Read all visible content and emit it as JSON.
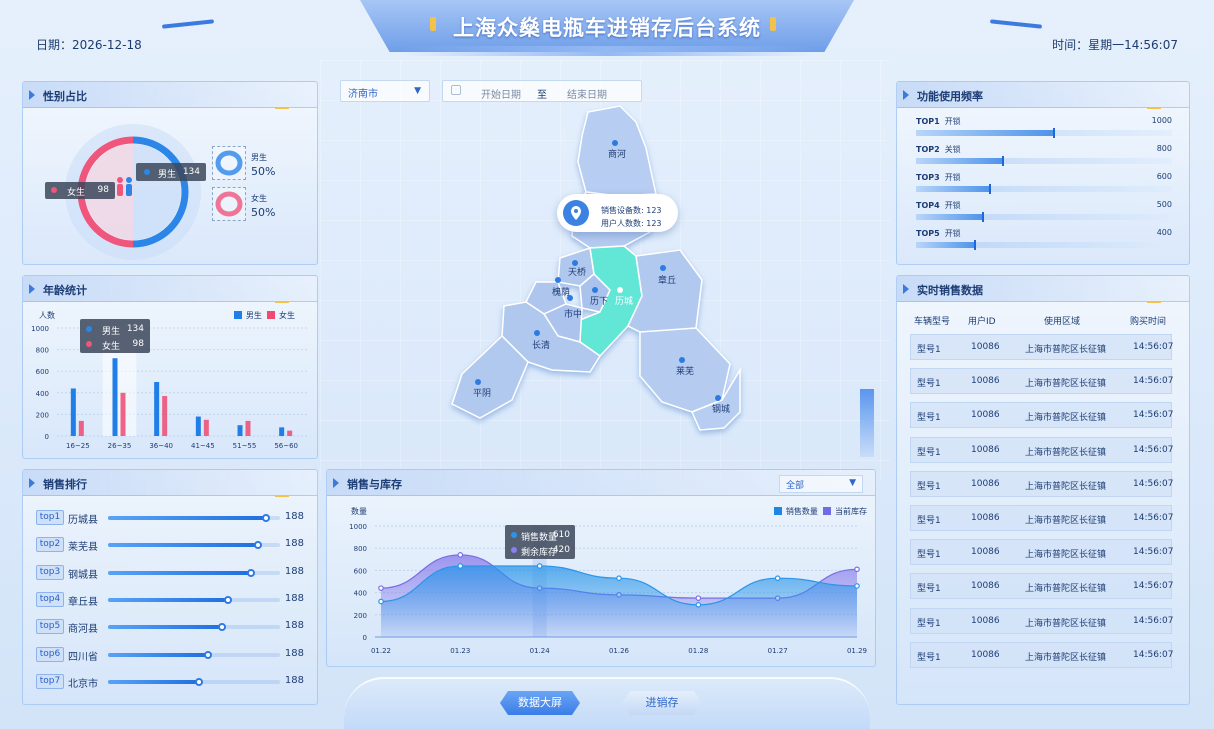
{
  "header": {
    "title": "上海众燊电瓶车进销存后台系统",
    "date_label": "日期：2026-12-18",
    "time_label": "时间：星期一14:56:07"
  },
  "filters": {
    "city": "济南市",
    "start_placeholder": "开始日期",
    "separator": "至",
    "end_placeholder": "结束日期"
  },
  "gender": {
    "title": "性别占比",
    "female_label": "女生",
    "female_count": "98",
    "male_label": "男生",
    "male_count": "134",
    "male_pct": "50%",
    "female_pct": "50%",
    "colors": {
      "male": "#2c86e8",
      "female": "#f0557c"
    }
  },
  "age": {
    "title": "年龄统计",
    "ylabel": "人数",
    "legend_male": "男生",
    "legend_female": "女生",
    "tooltip": {
      "male_label": "男生",
      "male_value": "134",
      "female_label": "女生",
      "female_value": "98"
    }
  },
  "ranking": {
    "title": "销售排行",
    "items": [
      {
        "tag": "top1",
        "name": "历城县",
        "value": "188",
        "pct": 0.92
      },
      {
        "tag": "top2",
        "name": "莱芜县",
        "value": "188",
        "pct": 0.87
      },
      {
        "tag": "top3",
        "name": "钢城县",
        "value": "188",
        "pct": 0.83
      },
      {
        "tag": "top4",
        "name": "章丘县",
        "value": "188",
        "pct": 0.7
      },
      {
        "tag": "top5",
        "name": "商河县",
        "value": "188",
        "pct": 0.66
      },
      {
        "tag": "top6",
        "name": "四川省",
        "value": "188",
        "pct": 0.58
      },
      {
        "tag": "top7",
        "name": "北京市",
        "value": "188",
        "pct": 0.53
      }
    ]
  },
  "map": {
    "regions": [
      "商河",
      "天桥",
      "槐荫",
      "历下",
      "历城",
      "市中",
      "章丘",
      "长清",
      "平阴",
      "莱芜",
      "钢城"
    ],
    "popup": {
      "devices_label": "销售设备数:",
      "devices_value": "123",
      "users_label": "用户人数数:",
      "users_value": "123"
    }
  },
  "sales": {
    "title": "销售与库存",
    "filter": "全部",
    "ylabel": "数量",
    "legend_sales": "销售数量",
    "legend_stock": "当前库存",
    "tooltip": {
      "sales_label": "销售数量",
      "sales_value": "610",
      "stock_label": "剩余库存",
      "stock_value": "420"
    }
  },
  "func": {
    "title": "功能使用频率",
    "items": [
      {
        "rank": "TOP1",
        "name": "开锁",
        "value": "1000",
        "pct": 0.54
      },
      {
        "rank": "TOP2",
        "name": "关锁",
        "value": "800",
        "pct": 0.34
      },
      {
        "rank": "TOP3",
        "name": "开锁",
        "value": "600",
        "pct": 0.29
      },
      {
        "rank": "TOP4",
        "name": "开锁",
        "value": "500",
        "pct": 0.26
      },
      {
        "rank": "TOP5",
        "name": "开锁",
        "value": "400",
        "pct": 0.23
      }
    ]
  },
  "realtime": {
    "title": "实时销售数据",
    "columns": [
      "车辆型号",
      "用户ID",
      "使用区域",
      "购买时间"
    ],
    "rows": [
      [
        "型号1",
        "10086",
        "上海市普陀区长征镇",
        "14:56:07"
      ],
      [
        "型号1",
        "10086",
        "上海市普陀区长征镇",
        "14:56:07"
      ],
      [
        "型号1",
        "10086",
        "上海市普陀区长征镇",
        "14:56:07"
      ],
      [
        "型号1",
        "10086",
        "上海市普陀区长征镇",
        "14:56:07"
      ],
      [
        "型号1",
        "10086",
        "上海市普陀区长征镇",
        "14:56:07"
      ],
      [
        "型号1",
        "10086",
        "上海市普陀区长征镇",
        "14:56:07"
      ],
      [
        "型号1",
        "10086",
        "上海市普陀区长征镇",
        "14:56:07"
      ],
      [
        "型号1",
        "10086",
        "上海市普陀区长征镇",
        "14:56:07"
      ],
      [
        "型号1",
        "10086",
        "上海市普陀区长征镇",
        "14:56:07"
      ],
      [
        "型号1",
        "10086",
        "上海市普陀区长征镇",
        "14:56:07"
      ]
    ]
  },
  "nav": {
    "screen": "数据大屏",
    "inventory": "进销存"
  },
  "chart_data": [
    {
      "type": "bar",
      "categories": [
        "16~25",
        "26~35",
        "36~40",
        "41~45",
        "51~55",
        "56~60"
      ],
      "series": [
        {
          "name": "男生",
          "values": [
            440,
            720,
            500,
            180,
            100,
            80
          ]
        },
        {
          "name": "女生",
          "values": [
            140,
            400,
            370,
            150,
            140,
            50
          ]
        }
      ],
      "ylabel": "人数",
      "ylim": [
        0,
        1000
      ],
      "yticks": [
        0,
        200,
        400,
        600,
        800,
        1000
      ],
      "colors": {
        "male": "#1f7ee8",
        "female": "#ef4a71"
      },
      "legend": "top-right"
    },
    {
      "type": "area",
      "x": [
        "01.22",
        "01.23",
        "01.24",
        "01.26",
        "01.28",
        "01.27",
        "01.29"
      ],
      "series": [
        {
          "name": "销售数量",
          "values": [
            320,
            640,
            640,
            530,
            290,
            530,
            460
          ]
        },
        {
          "name": "当前库存",
          "values": [
            440,
            740,
            440,
            380,
            350,
            350,
            610
          ]
        }
      ],
      "ylabel": "数量",
      "ylim": [
        0,
        1000
      ],
      "yticks": [
        0,
        200,
        400,
        600,
        800,
        1000
      ],
      "colors": {
        "sales": "#2a95e9",
        "stock": "#7b6ee6"
      },
      "legend": "top-right"
    }
  ]
}
